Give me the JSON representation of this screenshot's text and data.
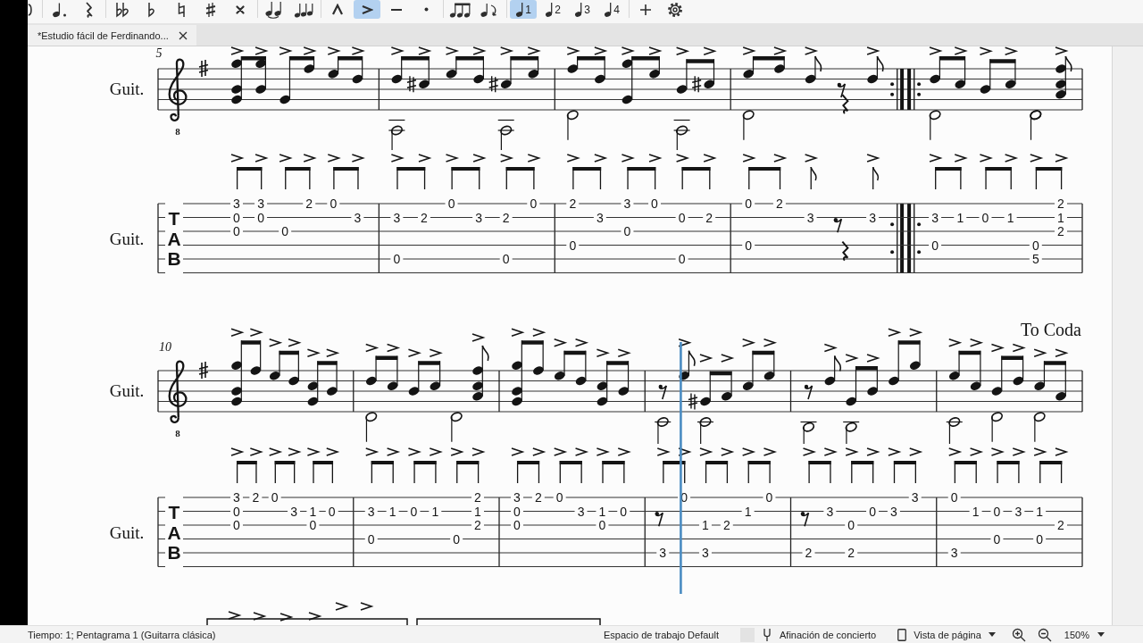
{
  "toolbar": {
    "groups": [
      {
        "items": [
          {
            "kind": "partial-curve",
            "selected": false
          }
        ]
      },
      {
        "items": [
          {
            "kind": "dotted-note",
            "selected": false
          },
          {
            "kind": "quarter-rest",
            "selected": false
          }
        ]
      },
      {
        "items": [
          {
            "kind": "double-flat",
            "selected": false
          },
          {
            "kind": "flat",
            "selected": false
          },
          {
            "kind": "natural",
            "selected": false
          },
          {
            "kind": "sharp",
            "selected": false
          },
          {
            "kind": "double-sharp",
            "selected": false
          }
        ]
      },
      {
        "items": [
          {
            "kind": "tie",
            "selected": false
          },
          {
            "kind": "slur-notes",
            "selected": false
          }
        ]
      },
      {
        "items": [
          {
            "kind": "marcato",
            "selected": false
          },
          {
            "kind": "accent",
            "selected": true
          },
          {
            "kind": "tenuto",
            "selected": false
          },
          {
            "kind": "staccato",
            "selected": false
          }
        ]
      },
      {
        "items": [
          {
            "kind": "beam",
            "selected": false
          },
          {
            "kind": "flip",
            "selected": false
          }
        ]
      },
      {
        "items": [
          {
            "kind": "voice",
            "label": "1",
            "selected": true
          },
          {
            "kind": "voice",
            "label": "2",
            "selected": false
          },
          {
            "kind": "voice",
            "label": "3",
            "selected": false
          },
          {
            "kind": "voice",
            "label": "4",
            "selected": false
          }
        ]
      },
      {
        "items": [
          {
            "kind": "plus",
            "selected": false
          },
          {
            "kind": "gear",
            "selected": false
          }
        ]
      }
    ]
  },
  "tabs": [
    {
      "label": "*Estudio fácil de Ferdinando...",
      "selected": true
    }
  ],
  "score": {
    "systems": [
      {
        "measure_number": "5",
        "notation_label": "Guit.",
        "clef_octave": "8",
        "tab_label": "Guit.",
        "tab_clef": "TAB",
        "measures": [
          {
            "beats": [
              {
                "s1": "3",
                "s2": "0",
                "s3": "0"
              },
              {
                "s1": "3",
                "s2": "0"
              },
              {
                "s3": "0"
              },
              {
                "s1": "2"
              },
              {
                "s1": "0"
              },
              {
                "s2": "3"
              }
            ]
          },
          {
            "beats": [
              {
                "s2": "3",
                "s5": "0"
              },
              {
                "s2": "2"
              },
              {
                "s1": "0"
              },
              {
                "s2": "3"
              },
              {
                "s2": "2",
                "s5": "0"
              },
              {
                "s1": "0"
              }
            ]
          },
          {
            "beats": [
              {
                "s1": "2",
                "s4": "0"
              },
              {
                "s2": "3"
              },
              {
                "s1": "3",
                "s3": "0"
              },
              {
                "s1": "0"
              },
              {
                "s2": "0",
                "s5": "0"
              },
              {
                "s2": "2"
              }
            ]
          },
          {
            "repeat_end": true,
            "beats": [
              {
                "s1": "0",
                "s4": "0"
              },
              {
                "s1": "2"
              },
              {
                "s2": "3"
              },
              {
                "rest": {
                  "kind": "eighth"
                },
                "bass_rest": {
                  "kind": "quarter"
                }
              },
              {
                "s2": "3"
              }
            ]
          },
          {
            "repeat_start": true,
            "beats": [
              {
                "s2": "3",
                "s4": "0"
              },
              {
                "s2": "1"
              },
              {
                "s2": "0"
              },
              {
                "s2": "1"
              },
              {
                "s4": "0",
                "s5": "5"
              },
              {
                "s1": "2",
                "s2": "1",
                "s3": "2"
              }
            ]
          }
        ]
      },
      {
        "measure_number": "10",
        "text_mark": "To Coda",
        "notation_label": "Guit.",
        "clef_octave": "8",
        "tab_label": "Guit.",
        "tab_clef": "TAB",
        "measures": [
          {
            "beats": [
              {
                "s1": "3",
                "s2": "0",
                "s3": "0"
              },
              {
                "s1": "2"
              },
              {
                "s1": "0"
              },
              {
                "s2": "3"
              },
              {
                "s2": "1",
                "s3": "0"
              },
              {
                "s2": "0"
              }
            ]
          },
          {
            "beats": [
              {
                "s2": "3",
                "s4": "0"
              },
              {
                "s2": "1"
              },
              {
                "s2": "0"
              },
              {
                "s2": "1"
              },
              {
                "s4": "0"
              },
              {
                "s1": "2",
                "s2": "1",
                "s3": "2"
              }
            ]
          },
          {
            "beats": [
              {
                "s1": "3",
                "s2": "0",
                "s3": "0"
              },
              {
                "s1": "2"
              },
              {
                "s1": "0"
              },
              {
                "s2": "3"
              },
              {
                "s2": "1",
                "s3": "0"
              },
              {
                "s2": "0"
              }
            ]
          },
          {
            "beats": [
              {
                "rest": {
                  "kind": "eighth"
                },
                "s5": "3"
              },
              {
                "s1": "0",
                "cursor": true
              },
              {
                "s3": "1",
                "s5": "3"
              },
              {
                "s3": "2"
              },
              {
                "s2": "1"
              },
              {
                "s1": "0"
              }
            ]
          },
          {
            "beats": [
              {
                "rest": {
                  "kind": "eighth"
                },
                "s5": "2"
              },
              {
                "s2": "3"
              },
              {
                "s3": "0",
                "s5": "2"
              },
              {
                "s2": "0"
              },
              {
                "s2": "3"
              },
              {
                "s1": "3"
              }
            ]
          },
          {
            "beats": [
              {
                "s1": "0",
                "s5": "3"
              },
              {
                "s2": "1"
              },
              {
                "s2": "0",
                "s4": "0"
              },
              {
                "s2": "3"
              },
              {
                "s2": "1",
                "s4": "0"
              },
              {
                "s3": "2"
              }
            ]
          }
        ]
      }
    ]
  },
  "status_bar": {
    "position_text": "Tiempo: 1; Pentagrama 1 (Guitarra clásica)",
    "workspace": "Espacio de trabajo Default",
    "concert_pitch": {
      "label": "Afinación de concierto",
      "checked": false
    },
    "view_mode": {
      "label": "Vista de página"
    },
    "zoom": {
      "label": "150%"
    }
  }
}
